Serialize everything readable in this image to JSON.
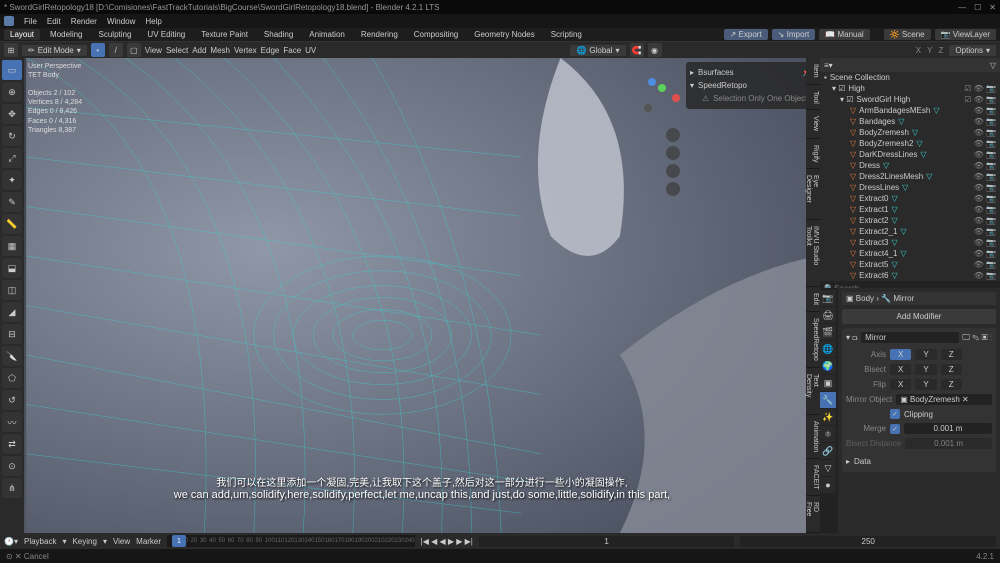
{
  "app": {
    "title": "* SwordGirlRetopology18 [D:\\Comisiones\\FastTrackTutorials\\BigCourse\\SwordGirlRetopology18.blend] - Blender 4.2.1 LTS",
    "version": "4.2.1"
  },
  "menu": {
    "items": [
      "File",
      "Edit",
      "Render",
      "Window",
      "Help"
    ]
  },
  "workspaces": {
    "tabs": [
      "Layout",
      "Modeling",
      "Sculpting",
      "UV Editing",
      "Texture Paint",
      "Shading",
      "Animation",
      "Rendering",
      "Compositing",
      "Geometry Nodes",
      "Scripting"
    ],
    "active": 0
  },
  "header_buttons": {
    "export": "Export",
    "import": "Import",
    "manual": "Manual",
    "scene": "Scene",
    "viewlayer": "ViewLayer"
  },
  "tool_header": {
    "mode": "Edit Mode",
    "view_menu": [
      "View",
      "Select",
      "Add",
      "Mesh",
      "Vertex",
      "Edge",
      "Face",
      "UV"
    ],
    "orientation": "Global",
    "options": "Options"
  },
  "viewport": {
    "view_label": "User Perspective",
    "object_name": "TET Body",
    "stats": {
      "objects": "Objects    2 / 102",
      "vertices": "Vertices    8 / 4,284",
      "edges": "Edges    0 / 8,426",
      "faces": "Faces    0 / 4,316",
      "triangles": "Triangles   8,387"
    },
    "xyz": "X Y Z"
  },
  "npanel": {
    "items": [
      "Bsurfaces",
      "SpeedRetopo",
      "Selection Only One Object"
    ],
    "tabs": [
      "Item",
      "Tool",
      "View",
      "Rigify",
      "Eye Designer",
      "IMVU Studio Toolkit",
      "Edit",
      "SpeedRetopo",
      "Text Density",
      "Animation",
      "FACEIT",
      "RD Free"
    ]
  },
  "outliner": {
    "header": "Scene Collection",
    "collection": "High",
    "active_collection": "SwordGirl High",
    "items": [
      {
        "name": "ArmBandagesMEsh",
        "selected": false
      },
      {
        "name": "Bandages",
        "selected": false
      },
      {
        "name": "BodyZremesh",
        "selected": false
      },
      {
        "name": "BodyZremesh2",
        "selected": false
      },
      {
        "name": "DarKDressLines",
        "selected": false
      },
      {
        "name": "Dress",
        "selected": false
      },
      {
        "name": "Dress2LinesMesh",
        "selected": false
      },
      {
        "name": "DressLines",
        "selected": false
      },
      {
        "name": "Extract0",
        "selected": false
      },
      {
        "name": "Extract1",
        "selected": false
      },
      {
        "name": "Extract2",
        "selected": false
      },
      {
        "name": "Extract2_1",
        "selected": false
      },
      {
        "name": "Extract3",
        "selected": false
      },
      {
        "name": "Extract4_1",
        "selected": false
      },
      {
        "name": "Extract5",
        "selected": false
      },
      {
        "name": "Extract6",
        "selected": false
      }
    ],
    "search_placeholder": "Search"
  },
  "properties": {
    "breadcrumb_obj": "Body",
    "breadcrumb_mod": "Mirror",
    "add_modifier": "Add Modifier",
    "modifier": {
      "name": "Mirror",
      "axis_label": "Axis",
      "bisect_label": "Bisect",
      "flip_label": "Flip",
      "axes": [
        "X",
        "Y",
        "Z"
      ],
      "mirror_object_label": "Mirror Object",
      "mirror_object": "BodyZremesh",
      "clipping_label": "Clipping",
      "merge_label": "Merge",
      "merge_value": "0.001 m",
      "bisect_distance_label": "Bisect Distance",
      "bisect_distance": "0.001 m",
      "data_section": "Data"
    }
  },
  "timeline": {
    "playback": "Playback",
    "keying": "Keying",
    "view": "View",
    "marker": "Marker",
    "frames": [
      "0",
      "10",
      "20",
      "30",
      "40",
      "50",
      "60",
      "70",
      "80",
      "90",
      "100",
      "110",
      "120",
      "130",
      "140",
      "150",
      "160",
      "170",
      "180",
      "190",
      "200",
      "210",
      "220",
      "230",
      "240"
    ],
    "current": "1",
    "end": "250"
  },
  "subtitle": {
    "zh": "我们可以在这里添加一个凝固,完美,让我取下这个盖子,然后对这一部分进行一些小的凝固操作,",
    "en": "we can add,um,solidify,here,solidify,perfect,let me,uncap this,and just,do some,little,solidify,in this part,"
  },
  "status": {
    "left": "⊙ ✕ Cancel"
  }
}
